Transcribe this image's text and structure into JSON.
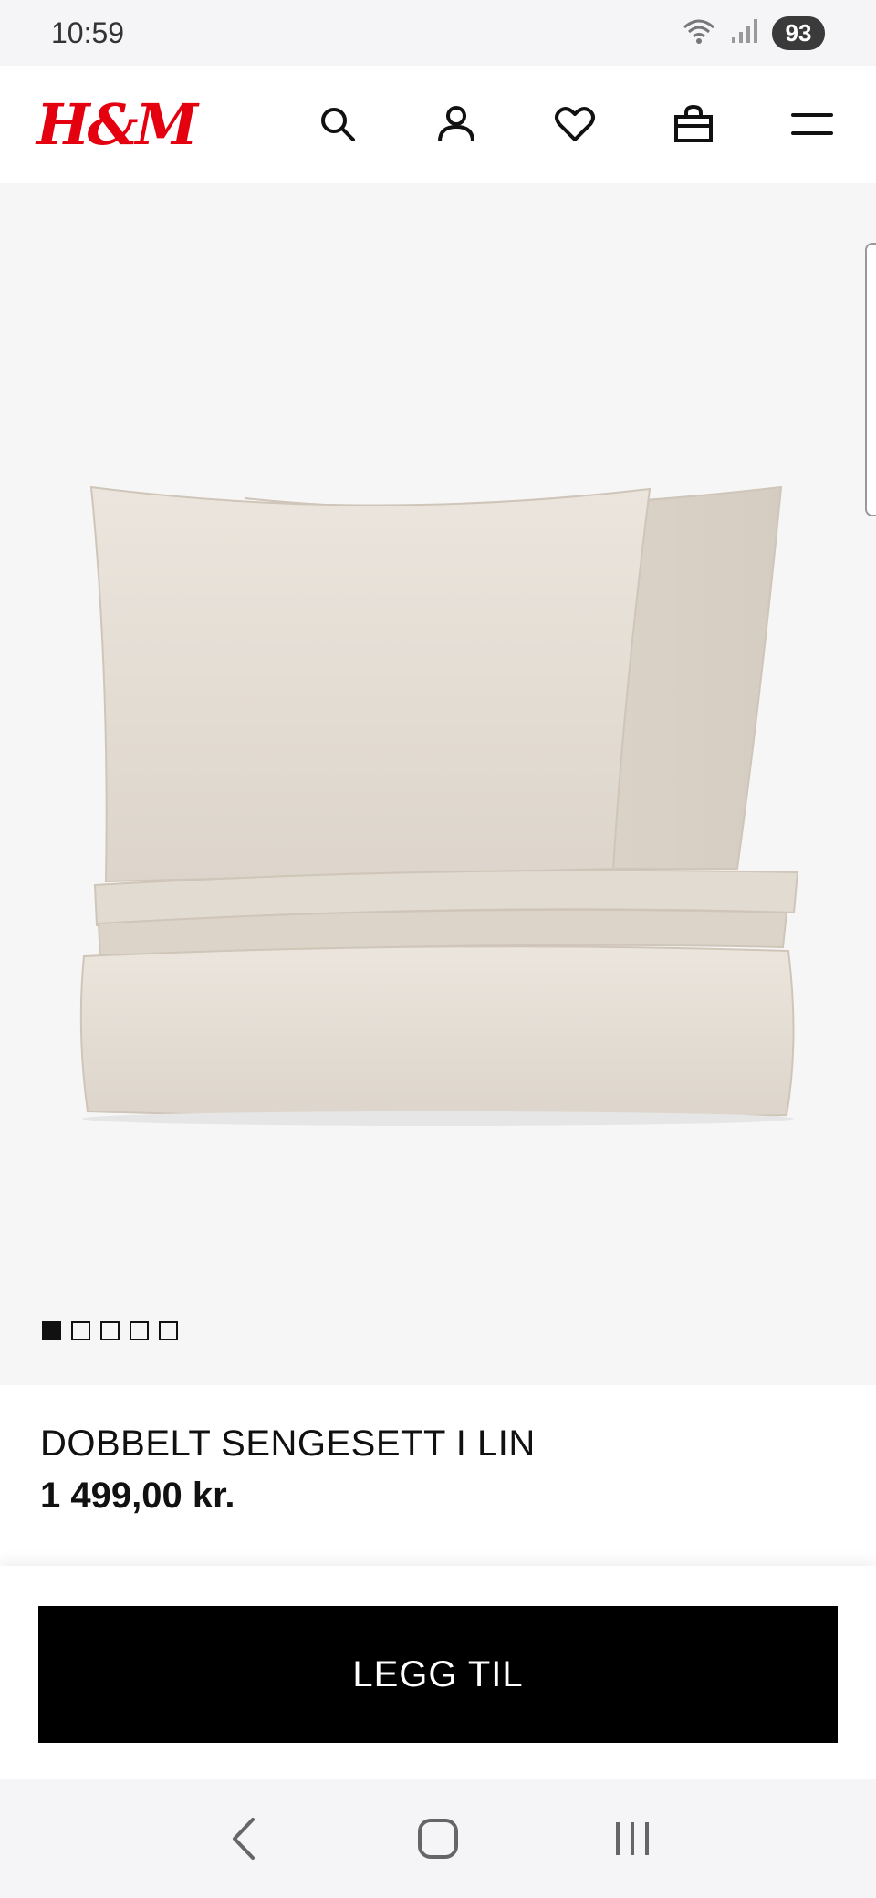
{
  "status_bar": {
    "time": "10:59",
    "battery": "93"
  },
  "header": {
    "logo": "H&M",
    "brand_color": "#e50010"
  },
  "gallery": {
    "image_count": 5,
    "active_index": 0
  },
  "product": {
    "name": "DOBBELT SENGESETT I LIN",
    "price": "1 499,00 kr."
  },
  "cta": {
    "add_label": "LEGG TIL"
  },
  "icons": {
    "header": [
      "search-icon",
      "account-icon",
      "heart-icon",
      "bag-icon",
      "menu-icon"
    ],
    "nav": [
      "back-icon",
      "home-icon",
      "recents-icon"
    ]
  }
}
